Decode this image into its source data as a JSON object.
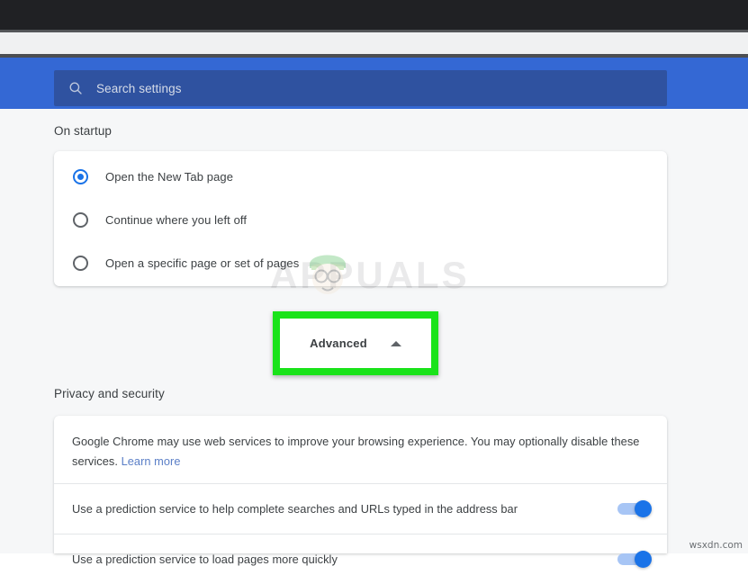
{
  "browser": {
    "titlebar_color": "#202124",
    "toolbar_color": "#f0f1f2"
  },
  "search": {
    "placeholder": "Search settings",
    "value": "",
    "icon": "search-icon",
    "band_color": "#3468d4",
    "field_color": "#2f52a0"
  },
  "sections": {
    "on_startup": {
      "title": "On startup",
      "options": [
        {
          "label": "Open the New Tab page",
          "selected": true
        },
        {
          "label": "Continue where you left off",
          "selected": false
        },
        {
          "label": "Open a specific page or set of pages",
          "selected": false
        }
      ]
    },
    "privacy": {
      "title": "Privacy and security",
      "description": "Google Chrome may use web services to improve your browsing experience. You may optionally disable these services.",
      "learn_more_label": "Learn more",
      "toggles": [
        {
          "label": "Use a prediction service to help complete searches and URLs typed in the address bar",
          "on": true
        },
        {
          "label": "Use a prediction service to load pages more quickly",
          "on": true
        }
      ]
    }
  },
  "advanced": {
    "label": "Advanced",
    "chevron": "chevron-up-icon",
    "highlight_color": "#1ae31a"
  },
  "watermarks": {
    "brand": "APPUALS",
    "credit": "wsxdn.com"
  },
  "colors": {
    "accent": "#1a73e8",
    "link": "#5b7fc7",
    "text": "#3c4043",
    "page_background": "#f6f7f8"
  }
}
